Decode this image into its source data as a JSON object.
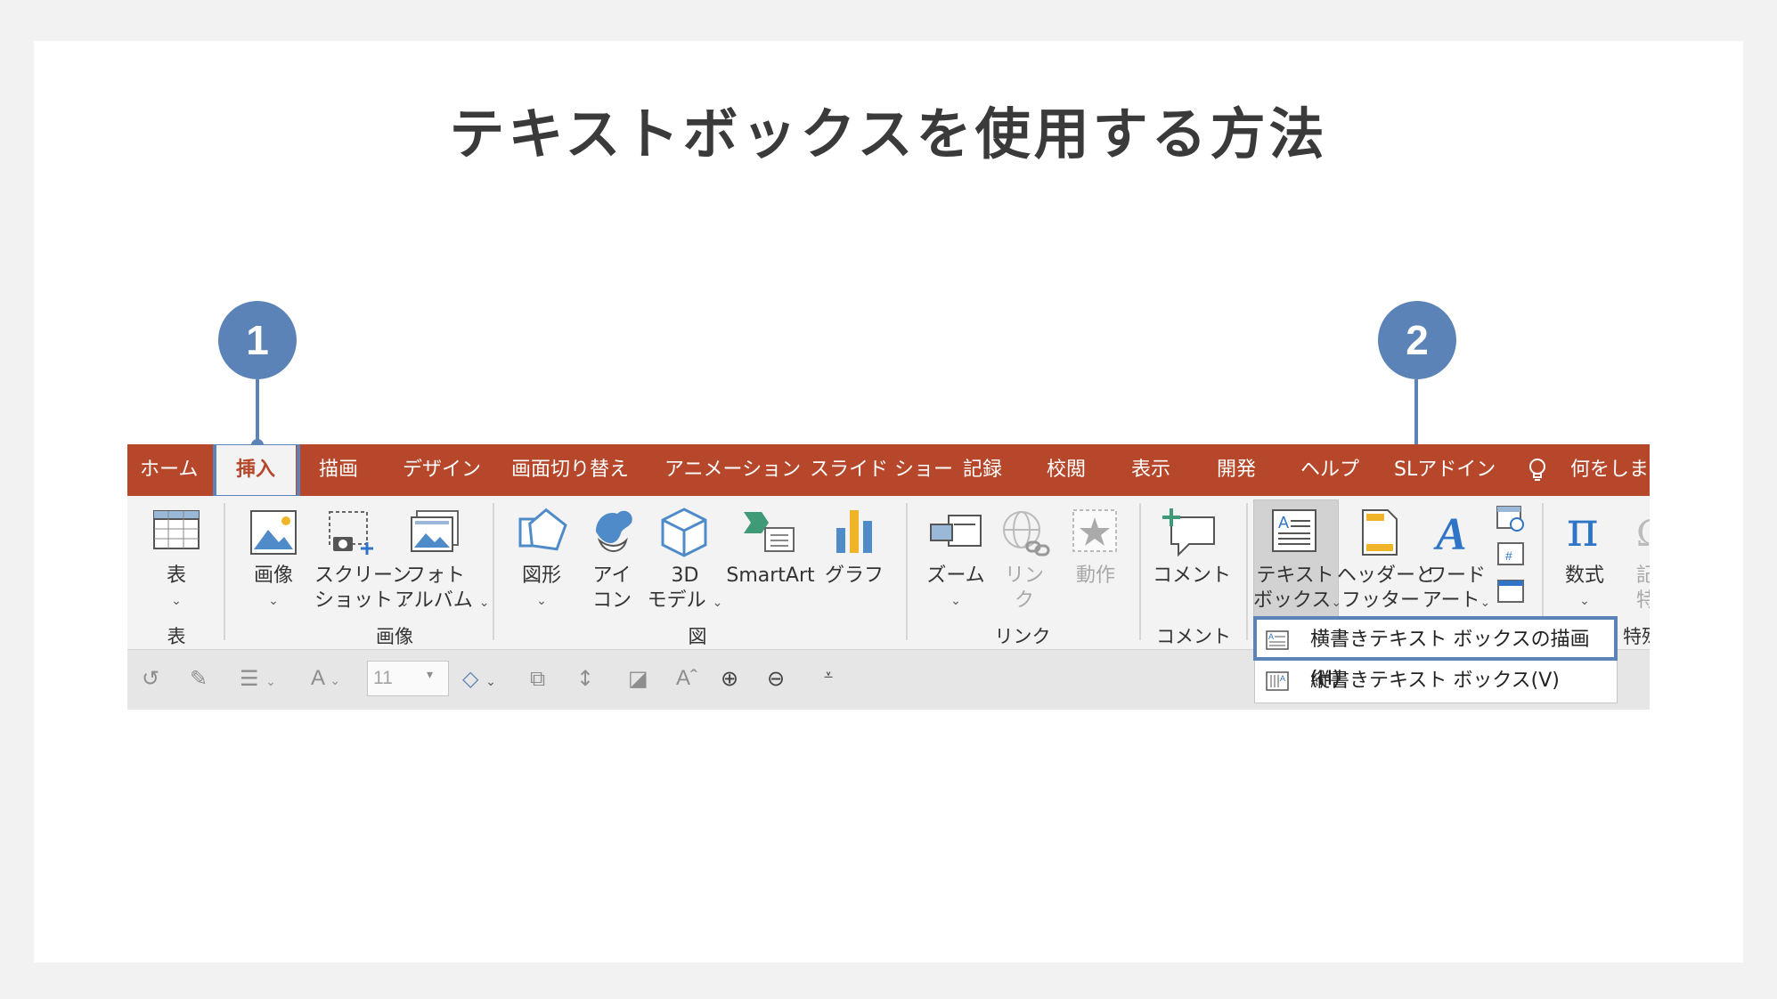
{
  "page": {
    "title": "テキストボックスを使用する方法"
  },
  "steps": [
    "1",
    "2"
  ],
  "colors": {
    "accent": "#5b83b8",
    "ribbon_red": "#b7472a"
  },
  "tabs": [
    {
      "label": "ホーム"
    },
    {
      "label": "挿入",
      "active": true
    },
    {
      "label": "描画"
    },
    {
      "label": "デザイン"
    },
    {
      "label": "画面切り替え"
    },
    {
      "label": "アニメーション"
    },
    {
      "label": "スライド ショー"
    },
    {
      "label": "記録"
    },
    {
      "label": "校閲"
    },
    {
      "label": "表示"
    },
    {
      "label": "開発"
    },
    {
      "label": "ヘルプ"
    },
    {
      "label": "SLアドイン"
    },
    {
      "label": "何をします"
    }
  ],
  "ribbon": {
    "table": {
      "line1": "表",
      "group": "表"
    },
    "image": {
      "line1": "画像"
    },
    "screenshot": {
      "line1": "スクリーン",
      "line2": "ショット"
    },
    "photo_album": {
      "line1": "フォト",
      "line2": "アルバム"
    },
    "image_group": "画像",
    "shapes": {
      "line1": "図形"
    },
    "icons": {
      "line1": "アイ",
      "line2": "コン"
    },
    "models3d": {
      "line1": "3D",
      "line2": "モデル"
    },
    "smartart": {
      "line1": "SmartArt"
    },
    "chart": {
      "line1": "グラフ"
    },
    "figure_group": "図",
    "zoom": {
      "line1": "ズーム"
    },
    "link": {
      "line1": "リン",
      "line2": "ク"
    },
    "action": {
      "line1": "動作"
    },
    "link_group": "リンク",
    "comment": {
      "line1": "コメント",
      "group": "コメント"
    },
    "textbox": {
      "line1": "テキスト",
      "line2": "ボックス"
    },
    "header_footer": {
      "line1": "ヘッダーと",
      "line2": "フッター"
    },
    "wordart": {
      "line1": "ワード",
      "line2": "アート"
    },
    "equation": {
      "line1": "数式"
    },
    "symbol": {
      "line1": "記",
      "line2": "特"
    },
    "special_group": "特殊"
  },
  "qat": {
    "font_size": "11",
    "font_glyph": "A"
  },
  "dropdown": {
    "items": [
      {
        "label": "横書きテキスト ボックスの描画(H)"
      },
      {
        "label": "縦書きテキスト ボックス(V)"
      }
    ]
  }
}
